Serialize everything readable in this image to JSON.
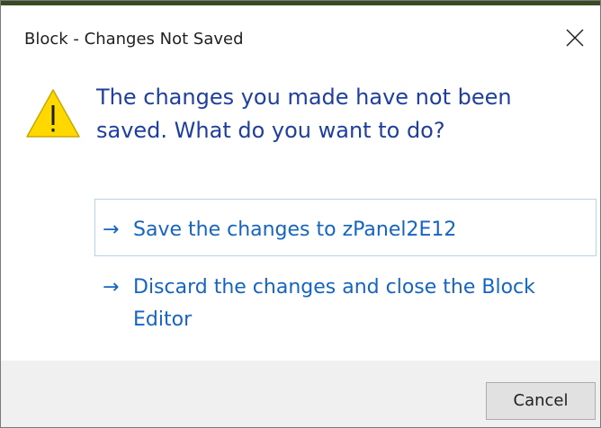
{
  "dialog": {
    "title": "Block - Changes Not Saved",
    "icon": "warning-icon",
    "instruction": "The changes you made have not been saved. What do you want to do?",
    "commands": [
      {
        "arrow": "→",
        "label": "Save the changes to zPanel2E12"
      },
      {
        "arrow": "→",
        "label": "Discard the changes and close the Block Editor"
      }
    ],
    "cancel_label": "Cancel",
    "colors": {
      "instruction": "#1e3f9e",
      "link": "#1565c0",
      "warning_fill": "#ffd800",
      "footer": "#f0f0f0"
    }
  }
}
